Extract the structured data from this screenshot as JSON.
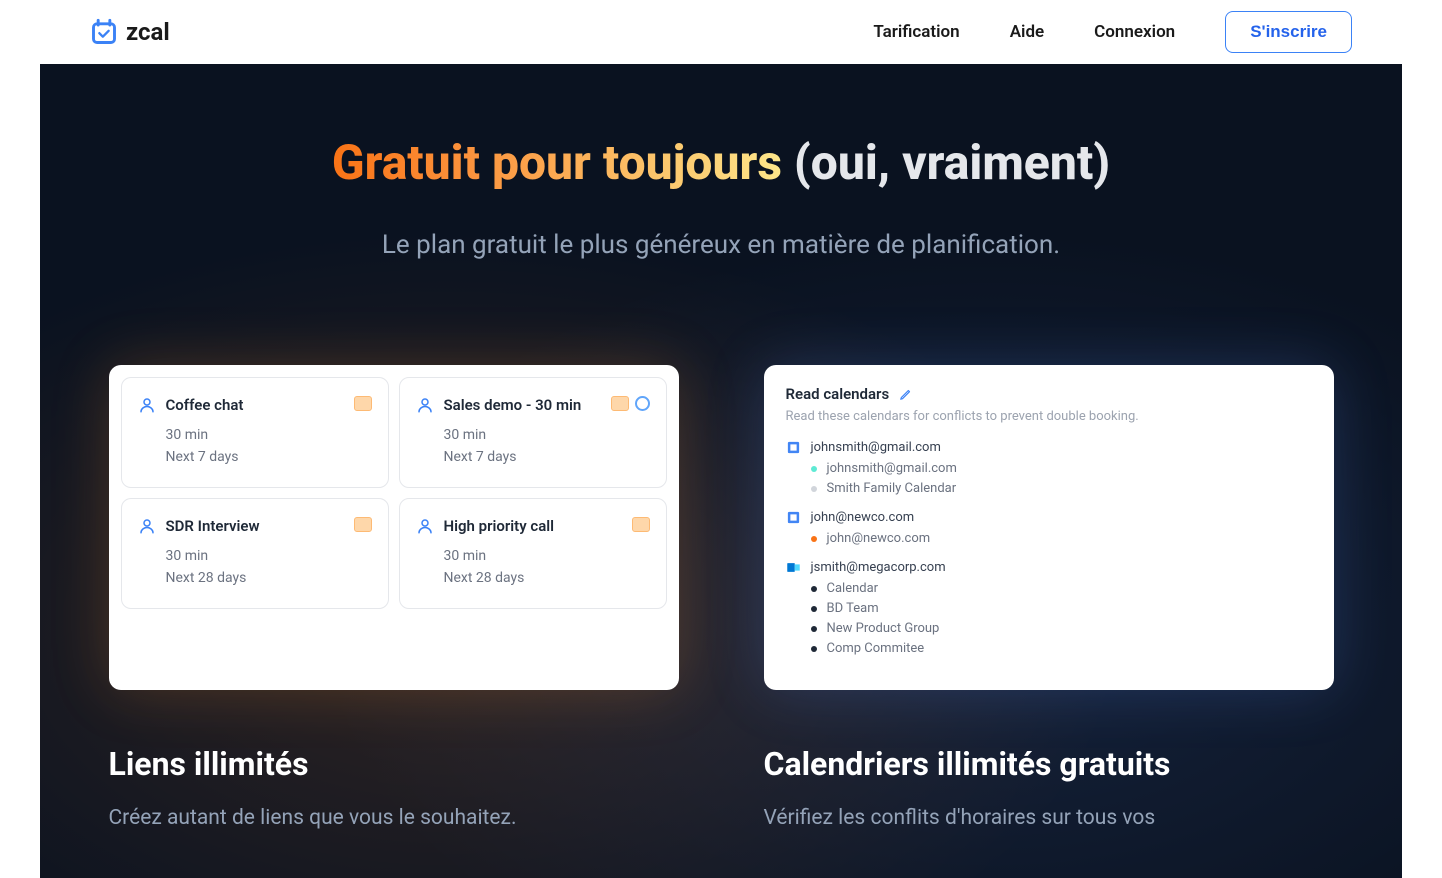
{
  "header": {
    "logo_text": "zcal",
    "nav": {
      "pricing": "Tarification",
      "help": "Aide",
      "login": "Connexion",
      "signup": "S'inscrire"
    }
  },
  "hero": {
    "title_gradient": "Gratuit pour toujours",
    "title_white": " (oui, vraiment)",
    "subtitle": "Le plan gratuit le plus généreux en matière de planification."
  },
  "events": [
    {
      "title": "Coffee chat",
      "duration": "30 min",
      "range": "Next 7 days"
    },
    {
      "title": "Sales demo - 30 min",
      "duration": "30 min",
      "range": "Next 7 days"
    },
    {
      "title": "SDR Interview",
      "duration": "30 min",
      "range": "Next 28 days"
    },
    {
      "title": "High priority call",
      "duration": "30 min",
      "range": "Next 28 days"
    }
  ],
  "calendars_panel": {
    "title": "Read calendars",
    "subtitle": "Read these calendars for conflicts to prevent double booking.",
    "accounts": [
      {
        "provider": "google",
        "email": "johnsmith@gmail.com",
        "items": [
          {
            "label": "johnsmith@gmail.com",
            "color": "#5eead4"
          },
          {
            "label": "Smith Family Calendar",
            "color": "#d1d5db"
          }
        ]
      },
      {
        "provider": "google",
        "email": "john@newco.com",
        "items": [
          {
            "label": "john@newco.com",
            "color": "#f97316"
          }
        ]
      },
      {
        "provider": "outlook",
        "email": "jsmith@megacorp.com",
        "items": [
          {
            "label": "Calendar",
            "color": "#1f2937"
          },
          {
            "label": "BD Team",
            "color": "#1f2937"
          },
          {
            "label": "New Product Group",
            "color": "#1f2937"
          },
          {
            "label": "Comp Commitee",
            "color": "#1f2937"
          }
        ]
      }
    ]
  },
  "features": {
    "left": {
      "title": "Liens illimités",
      "desc": "Créez autant de liens que vous le souhaitez."
    },
    "right": {
      "title": "Calendriers illimités gratuits",
      "desc": "Vérifiez les conflits d'horaires sur tous vos"
    }
  }
}
